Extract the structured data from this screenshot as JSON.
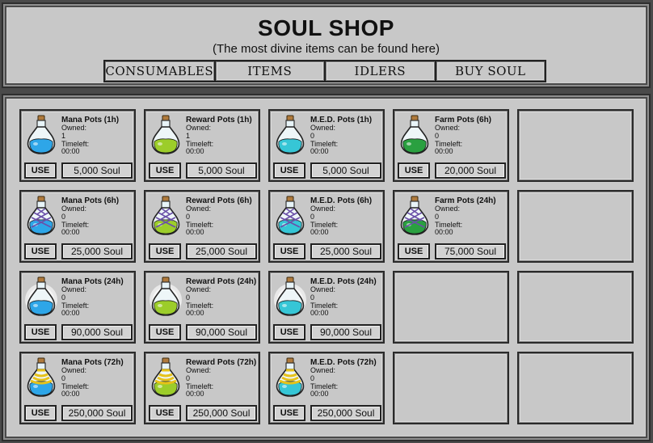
{
  "header": {
    "title": "SOUL SHOP",
    "subtitle": "(The most divine items can be found here)",
    "tabs": [
      "CONSUMABLES",
      "ITEMS",
      "IDLERS",
      "BUY SOUL"
    ]
  },
  "labels": {
    "owned": "Owned:",
    "timeleft": "Timeleft:",
    "use": "USE"
  },
  "colors": {
    "mana": "#2ea6e8",
    "reward": "#9ccd2a",
    "med": "#36c6d6",
    "farm": "#2aa040"
  },
  "items": [
    {
      "name": "Mana Pots (1h)",
      "owned": "1",
      "timeleft": "00:00",
      "price": "5,000 Soul",
      "potion": "mana",
      "style": "round"
    },
    {
      "name": "Reward Pots (1h)",
      "owned": "1",
      "timeleft": "00:00",
      "price": "5,000 Soul",
      "potion": "reward",
      "style": "round"
    },
    {
      "name": "M.E.D. Pots (1h)",
      "owned": "0",
      "timeleft": "00:00",
      "price": "5,000 Soul",
      "potion": "med",
      "style": "round"
    },
    {
      "name": "Farm Pots (6h)",
      "owned": "0",
      "timeleft": "00:00",
      "price": "20,000 Soul",
      "potion": "farm",
      "style": "round"
    },
    {
      "name": "Mana Pots (6h)",
      "owned": "0",
      "timeleft": "00:00",
      "price": "25,000 Soul",
      "potion": "mana",
      "style": "wrapped"
    },
    {
      "name": "Reward Pots (6h)",
      "owned": "0",
      "timeleft": "00:00",
      "price": "25,000 Soul",
      "potion": "reward",
      "style": "wrapped"
    },
    {
      "name": "M.E.D. Pots (6h)",
      "owned": "0",
      "timeleft": "00:00",
      "price": "25,000 Soul",
      "potion": "med",
      "style": "wrapped"
    },
    {
      "name": "Farm Pots (24h)",
      "owned": "0",
      "timeleft": "00:00",
      "price": "75,000 Soul",
      "potion": "farm",
      "style": "wrapped"
    },
    {
      "name": "Mana Pots (24h)",
      "owned": "0",
      "timeleft": "00:00",
      "price": "90,000 Soul",
      "potion": "mana",
      "style": "glow"
    },
    {
      "name": "Reward Pots (24h)",
      "owned": "0",
      "timeleft": "00:00",
      "price": "90,000 Soul",
      "potion": "reward",
      "style": "glow"
    },
    {
      "name": "M.E.D. Pots (24h)",
      "owned": "0",
      "timeleft": "00:00",
      "price": "90,000 Soul",
      "potion": "med",
      "style": "glow"
    },
    {
      "name": "Mana Pots (72h)",
      "owned": "0",
      "timeleft": "00:00",
      "price": "250,000 Soul",
      "potion": "mana",
      "style": "gold"
    },
    {
      "name": "Reward Pots (72h)",
      "owned": "0",
      "timeleft": "00:00",
      "price": "250,000 Soul",
      "potion": "reward",
      "style": "gold"
    },
    {
      "name": "M.E.D. Pots (72h)",
      "owned": "0",
      "timeleft": "00:00",
      "price": "250,000 Soul",
      "potion": "med",
      "style": "gold"
    }
  ]
}
